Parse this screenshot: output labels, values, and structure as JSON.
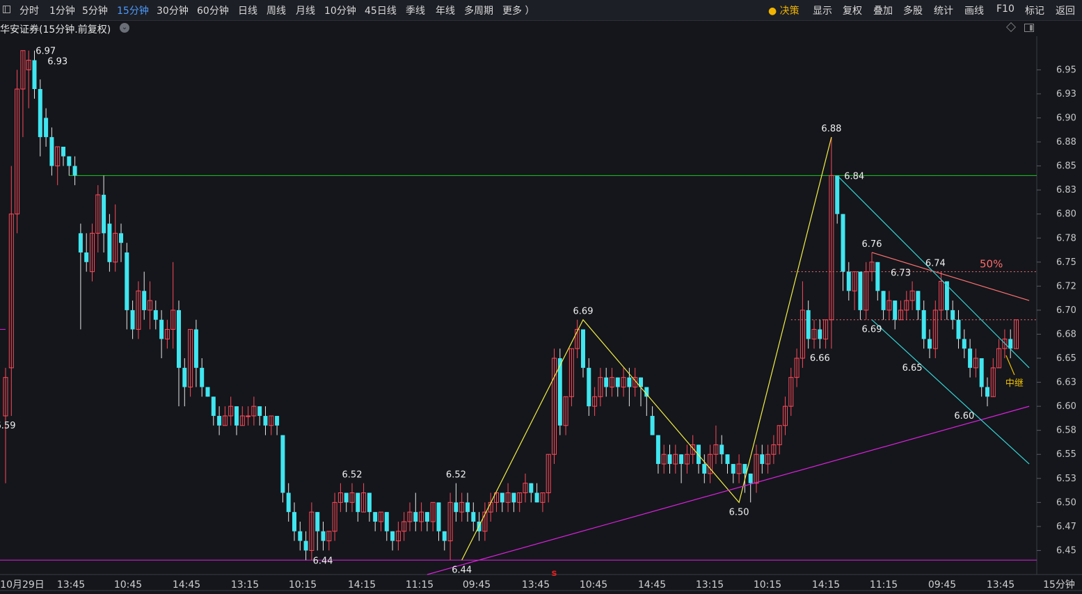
{
  "toolbar": {
    "periods": [
      "分时",
      "1分钟",
      "5分钟",
      "15分钟",
      "30分钟",
      "60分钟",
      "日线",
      "周线",
      "月线",
      "10分钟",
      "45日线",
      "季线",
      "年线",
      "多周期",
      "更多 ）"
    ],
    "active_period": "15分钟",
    "decision": "决策",
    "right": [
      "显示",
      "复权",
      "叠加",
      "多股",
      "统计",
      "画线",
      "F10",
      "标记",
      "返回"
    ]
  },
  "stock_title": "华安证券(15分钟.前复权)",
  "period_label": "15分钟",
  "chart_data": {
    "type": "candlestick",
    "y_axis": {
      "ylim": [
        6.425,
        6.985
      ],
      "ticks": [
        "6.95",
        "6.93",
        "6.90",
        "6.88",
        "6.85",
        "6.83",
        "6.80",
        "6.78",
        "6.75",
        "6.72",
        "6.70",
        "6.68",
        "6.65",
        "6.63",
        "6.60",
        "6.58",
        "6.55",
        "6.53",
        "6.50",
        "6.47",
        "6.45"
      ]
    },
    "x_axis": {
      "labels": [
        "10月29日",
        "13:45",
        "10:45",
        "14:45",
        "13:15",
        "10:15",
        "14:15",
        "11:15",
        "09:45",
        "13:45",
        "10:45",
        "14:45",
        "13:15",
        "10:15",
        "14:15",
        "11:15",
        "09:45",
        "13:45"
      ]
    },
    "candles": [
      [
        6.59,
        6.63,
        6.52,
        6.64
      ],
      [
        6.64,
        6.8,
        6.59,
        6.85
      ],
      [
        6.8,
        6.93,
        6.78,
        6.95
      ],
      [
        6.93,
        6.97,
        6.88,
        6.97
      ],
      [
        6.95,
        6.96,
        6.91,
        6.97
      ],
      [
        6.96,
        6.93,
        6.92,
        6.97
      ],
      [
        6.93,
        6.88,
        6.86,
        6.94
      ],
      [
        6.9,
        6.88,
        6.87,
        6.91
      ],
      [
        6.88,
        6.85,
        6.84,
        6.89
      ],
      [
        6.85,
        6.87,
        6.83,
        6.87
      ],
      [
        6.87,
        6.86,
        6.85,
        6.87
      ],
      [
        6.86,
        6.85,
        6.84,
        6.86
      ],
      [
        6.85,
        6.84,
        6.83,
        6.86
      ],
      [
        6.78,
        6.76,
        6.68,
        6.79
      ],
      [
        6.76,
        6.75,
        6.74,
        6.78
      ],
      [
        6.74,
        6.78,
        6.73,
        6.79
      ],
      [
        6.78,
        6.82,
        6.76,
        6.83
      ],
      [
        6.82,
        6.78,
        6.76,
        6.84
      ],
      [
        6.79,
        6.75,
        6.74,
        6.8
      ],
      [
        6.75,
        6.78,
        6.74,
        6.81
      ],
      [
        6.78,
        6.77,
        6.75,
        6.79
      ],
      [
        6.76,
        6.7,
        6.68,
        6.77
      ],
      [
        6.7,
        6.68,
        6.67,
        6.71
      ],
      [
        6.68,
        6.72,
        6.67,
        6.73
      ],
      [
        6.72,
        6.7,
        6.69,
        6.74
      ],
      [
        6.7,
        6.71,
        6.68,
        6.73
      ],
      [
        6.7,
        6.69,
        6.68,
        6.71
      ],
      [
        6.69,
        6.67,
        6.65,
        6.7
      ],
      [
        6.67,
        6.68,
        6.66,
        6.69
      ],
      [
        6.68,
        6.7,
        6.66,
        6.75
      ],
      [
        6.7,
        6.64,
        6.6,
        6.71
      ],
      [
        6.64,
        6.62,
        6.6,
        6.65
      ],
      [
        6.62,
        6.68,
        6.61,
        6.68
      ],
      [
        6.68,
        6.64,
        6.62,
        6.69
      ],
      [
        6.64,
        6.62,
        6.61,
        6.65
      ],
      [
        6.62,
        6.61,
        6.61,
        6.62
      ],
      [
        6.61,
        6.59,
        6.58,
        6.61
      ],
      [
        6.59,
        6.58,
        6.57,
        6.6
      ],
      [
        6.58,
        6.59,
        6.58,
        6.6
      ],
      [
        6.59,
        6.6,
        6.58,
        6.61
      ],
      [
        6.6,
        6.58,
        6.57,
        6.6
      ],
      [
        6.58,
        6.59,
        6.58,
        6.6
      ],
      [
        6.59,
        6.59,
        6.58,
        6.6
      ],
      [
        6.59,
        6.6,
        6.58,
        6.61
      ],
      [
        6.6,
        6.59,
        6.58,
        6.6
      ],
      [
        6.59,
        6.58,
        6.57,
        6.6
      ],
      [
        6.58,
        6.59,
        6.57,
        6.59
      ],
      [
        6.59,
        6.58,
        6.57,
        6.59
      ],
      [
        6.57,
        6.51,
        6.5,
        6.57
      ],
      [
        6.51,
        6.49,
        6.48,
        6.52
      ],
      [
        6.49,
        6.47,
        6.46,
        6.5
      ],
      [
        6.47,
        6.46,
        6.45,
        6.48
      ],
      [
        6.46,
        6.45,
        6.44,
        6.47
      ],
      [
        6.45,
        6.49,
        6.44,
        6.5
      ],
      [
        6.49,
        6.47,
        6.45,
        6.49
      ],
      [
        6.47,
        6.46,
        6.45,
        6.48
      ],
      [
        6.46,
        6.47,
        6.45,
        6.47
      ],
      [
        6.47,
        6.5,
        6.46,
        6.51
      ],
      [
        6.5,
        6.51,
        6.49,
        6.52
      ],
      [
        6.51,
        6.5,
        6.49,
        6.51
      ],
      [
        6.5,
        6.51,
        6.49,
        6.52
      ],
      [
        6.51,
        6.49,
        6.48,
        6.51
      ],
      [
        6.49,
        6.51,
        6.49,
        6.52
      ],
      [
        6.51,
        6.49,
        6.48,
        6.51
      ],
      [
        6.49,
        6.48,
        6.47,
        6.49
      ],
      [
        6.48,
        6.49,
        6.47,
        6.49
      ],
      [
        6.49,
        6.47,
        6.46,
        6.49
      ],
      [
        6.47,
        6.46,
        6.45,
        6.47
      ],
      [
        6.46,
        6.47,
        6.45,
        6.48
      ],
      [
        6.47,
        6.48,
        6.46,
        6.49
      ],
      [
        6.48,
        6.49,
        6.47,
        6.5
      ],
      [
        6.49,
        6.48,
        6.47,
        6.51
      ],
      [
        6.48,
        6.49,
        6.47,
        6.5
      ],
      [
        6.49,
        6.48,
        6.47,
        6.49
      ],
      [
        6.48,
        6.5,
        6.47,
        6.5
      ],
      [
        6.5,
        6.47,
        6.46,
        6.5
      ],
      [
        6.47,
        6.46,
        6.45,
        6.47
      ],
      [
        6.46,
        6.5,
        6.44,
        6.51
      ],
      [
        6.5,
        6.49,
        6.48,
        6.52
      ],
      [
        6.49,
        6.5,
        6.48,
        6.51
      ],
      [
        6.5,
        6.49,
        6.48,
        6.51
      ],
      [
        6.49,
        6.48,
        6.47,
        6.5
      ],
      [
        6.48,
        6.47,
        6.46,
        6.49
      ],
      [
        6.47,
        6.49,
        6.46,
        6.5
      ],
      [
        6.49,
        6.5,
        6.48,
        6.51
      ],
      [
        6.5,
        6.51,
        6.49,
        6.51
      ],
      [
        6.51,
        6.5,
        6.49,
        6.51
      ],
      [
        6.5,
        6.51,
        6.49,
        6.52
      ],
      [
        6.51,
        6.5,
        6.49,
        6.51
      ],
      [
        6.5,
        6.51,
        6.49,
        6.51
      ],
      [
        6.51,
        6.52,
        6.5,
        6.53
      ],
      [
        6.52,
        6.51,
        6.5,
        6.52
      ],
      [
        6.51,
        6.5,
        6.5,
        6.52
      ],
      [
        6.5,
        6.51,
        6.49,
        6.51
      ],
      [
        6.51,
        6.55,
        6.5,
        6.55
      ],
      [
        6.55,
        6.65,
        6.54,
        6.66
      ],
      [
        6.65,
        6.58,
        6.57,
        6.66
      ],
      [
        6.58,
        6.61,
        6.57,
        6.61
      ],
      [
        6.61,
        6.66,
        6.6,
        6.66
      ],
      [
        6.66,
        6.68,
        6.65,
        6.69
      ],
      [
        6.68,
        6.64,
        6.63,
        6.68
      ],
      [
        6.64,
        6.6,
        6.59,
        6.65
      ],
      [
        6.6,
        6.61,
        6.59,
        6.62
      ],
      [
        6.61,
        6.63,
        6.6,
        6.64
      ],
      [
        6.63,
        6.62,
        6.61,
        6.64
      ],
      [
        6.62,
        6.63,
        6.61,
        6.64
      ],
      [
        6.63,
        6.62,
        6.61,
        6.63
      ],
      [
        6.62,
        6.63,
        6.61,
        6.64
      ],
      [
        6.63,
        6.62,
        6.6,
        6.64
      ],
      [
        6.62,
        6.63,
        6.61,
        6.64
      ],
      [
        6.63,
        6.62,
        6.6,
        6.63
      ],
      [
        6.62,
        6.61,
        6.59,
        6.62
      ],
      [
        6.59,
        6.57,
        6.57,
        6.6
      ],
      [
        6.57,
        6.54,
        6.53,
        6.57
      ],
      [
        6.54,
        6.55,
        6.53,
        6.56
      ],
      [
        6.55,
        6.54,
        6.53,
        6.56
      ],
      [
        6.54,
        6.55,
        6.53,
        6.56
      ],
      [
        6.55,
        6.54,
        6.52,
        6.55
      ],
      [
        6.54,
        6.55,
        6.53,
        6.56
      ],
      [
        6.55,
        6.56,
        6.54,
        6.57
      ],
      [
        6.56,
        6.54,
        6.53,
        6.56
      ],
      [
        6.54,
        6.53,
        6.52,
        6.55
      ],
      [
        6.53,
        6.55,
        6.52,
        6.56
      ],
      [
        6.55,
        6.56,
        6.54,
        6.58
      ],
      [
        6.56,
        6.55,
        6.54,
        6.57
      ],
      [
        6.55,
        6.54,
        6.53,
        6.55
      ],
      [
        6.54,
        6.53,
        6.52,
        6.54
      ],
      [
        6.53,
        6.54,
        6.52,
        6.55
      ],
      [
        6.54,
        6.53,
        6.51,
        6.54
      ],
      [
        6.53,
        6.52,
        6.5,
        6.53
      ],
      [
        6.52,
        6.55,
        6.51,
        6.56
      ],
      [
        6.55,
        6.54,
        6.53,
        6.56
      ],
      [
        6.54,
        6.55,
        6.53,
        6.56
      ],
      [
        6.55,
        6.56,
        6.54,
        6.57
      ],
      [
        6.56,
        6.58,
        6.55,
        6.58
      ],
      [
        6.58,
        6.6,
        6.57,
        6.61
      ],
      [
        6.6,
        6.63,
        6.59,
        6.64
      ],
      [
        6.63,
        6.65,
        6.62,
        6.66
      ],
      [
        6.65,
        6.7,
        6.64,
        6.73
      ],
      [
        6.7,
        6.67,
        6.66,
        6.71
      ],
      [
        6.67,
        6.68,
        6.66,
        6.69
      ],
      [
        6.68,
        6.67,
        6.66,
        6.69
      ],
      [
        6.67,
        6.69,
        6.66,
        6.69
      ],
      [
        6.69,
        6.84,
        6.66,
        6.88
      ],
      [
        6.84,
        6.8,
        6.79,
        6.84
      ],
      [
        6.8,
        6.74,
        6.72,
        6.8
      ],
      [
        6.74,
        6.72,
        6.71,
        6.75
      ],
      [
        6.72,
        6.74,
        6.7,
        6.74
      ],
      [
        6.74,
        6.7,
        6.69,
        6.74
      ],
      [
        6.7,
        6.74,
        6.69,
        6.75
      ],
      [
        6.74,
        6.75,
        6.73,
        6.76
      ],
      [
        6.75,
        6.72,
        6.71,
        6.75
      ],
      [
        6.72,
        6.7,
        6.69,
        6.72
      ],
      [
        6.7,
        6.71,
        6.69,
        6.72
      ],
      [
        6.71,
        6.69,
        6.68,
        6.71
      ],
      [
        6.69,
        6.7,
        6.69,
        6.71
      ],
      [
        6.7,
        6.71,
        6.69,
        6.72
      ],
      [
        6.71,
        6.72,
        6.7,
        6.73
      ],
      [
        6.72,
        6.7,
        6.69,
        6.72
      ],
      [
        6.7,
        6.67,
        6.66,
        6.71
      ],
      [
        6.67,
        6.66,
        6.65,
        6.68
      ],
      [
        6.66,
        6.7,
        6.65,
        6.71
      ],
      [
        6.7,
        6.73,
        6.69,
        6.74
      ],
      [
        6.73,
        6.7,
        6.69,
        6.73
      ],
      [
        6.7,
        6.69,
        6.68,
        6.71
      ],
      [
        6.69,
        6.67,
        6.66,
        6.7
      ],
      [
        6.67,
        6.66,
        6.65,
        6.68
      ],
      [
        6.66,
        6.64,
        6.63,
        6.67
      ],
      [
        6.64,
        6.65,
        6.63,
        6.66
      ],
      [
        6.65,
        6.62,
        6.61,
        6.65
      ],
      [
        6.62,
        6.61,
        6.6,
        6.63
      ],
      [
        6.61,
        6.64,
        6.61,
        6.65
      ],
      [
        6.64,
        6.66,
        6.64,
        6.67
      ],
      [
        6.66,
        6.67,
        6.65,
        6.68
      ],
      [
        6.67,
        6.66,
        6.65,
        6.68
      ],
      [
        6.66,
        6.69,
        6.66,
        6.69
      ]
    ],
    "horizontal_lines": [
      {
        "price": 6.84,
        "color": "#1fc91f",
        "style": "solid"
      },
      {
        "price": 6.44,
        "color": "#e020e0",
        "style": "solid"
      },
      {
        "price": 6.74,
        "color": "#ff7070",
        "style": "dotted"
      },
      {
        "price": 6.69,
        "color": "#ff7070",
        "style": "dotted"
      }
    ],
    "level_50pct": {
      "price": 6.74,
      "label": "50%"
    },
    "price_labels": [
      {
        "text": "6.97",
        "bar": 4,
        "price": 6.97,
        "pos": "right"
      },
      {
        "text": "6.93",
        "bar": 9,
        "price": 6.95,
        "pos": "above"
      },
      {
        "text": "6.59",
        "bar": 0,
        "price": 6.59,
        "pos": "below"
      },
      {
        "text": "6.44",
        "bar": 52,
        "price": 6.44,
        "pos": "right"
      },
      {
        "text": "6.52",
        "bar": 60,
        "price": 6.52,
        "pos": "above"
      },
      {
        "text": "6.52",
        "bar": 78,
        "price": 6.52,
        "pos": "above"
      },
      {
        "text": "6.44",
        "bar": 79,
        "price": 6.44,
        "pos": "below"
      },
      {
        "text": "6.69",
        "bar": 100,
        "price": 6.69,
        "pos": "above"
      },
      {
        "text": "6.50",
        "bar": 127,
        "price": 6.5,
        "pos": "below"
      },
      {
        "text": "6.88",
        "bar": 143,
        "price": 6.88,
        "pos": "above"
      },
      {
        "text": "6.84",
        "bar": 144,
        "price": 6.84,
        "pos": "right"
      },
      {
        "text": "6.66",
        "bar": 141,
        "price": 6.66,
        "pos": "below"
      },
      {
        "text": "6.76",
        "bar": 150,
        "price": 6.76,
        "pos": "above"
      },
      {
        "text": "6.73",
        "bar": 155,
        "price": 6.73,
        "pos": "above"
      },
      {
        "text": "6.74",
        "bar": 161,
        "price": 6.74,
        "pos": "above"
      },
      {
        "text": "6.69",
        "bar": 150,
        "price": 6.69,
        "pos": "below"
      },
      {
        "text": "6.65",
        "bar": 157,
        "price": 6.65,
        "pos": "below"
      },
      {
        "text": "6.60",
        "bar": 166,
        "price": 6.6,
        "pos": "below"
      }
    ],
    "zigzag": [
      [
        79,
        6.44
      ],
      [
        100,
        6.69
      ],
      [
        127,
        6.5
      ],
      [
        143,
        6.88
      ]
    ],
    "trend_lines": [
      {
        "from": [
          73,
          6.425
        ],
        "to": [
          177,
          6.6
        ],
        "color": "#e020e0"
      },
      {
        "from": [
          150,
          6.76
        ],
        "to": [
          177,
          6.71
        ],
        "color": "#ff7070"
      },
      {
        "from": [
          144,
          6.84
        ],
        "to": [
          177,
          6.64
        ],
        "color": "#35d6d6"
      },
      {
        "from": [
          150,
          6.69
        ],
        "to": [
          177,
          6.54
        ],
        "color": "#35d6d6"
      }
    ],
    "annotation": {
      "text": "中继",
      "bar": 173,
      "price": 6.65,
      "color": "#f0c000"
    },
    "signal_mark": {
      "text": "s",
      "bar": 95,
      "color": "#e02020"
    }
  }
}
